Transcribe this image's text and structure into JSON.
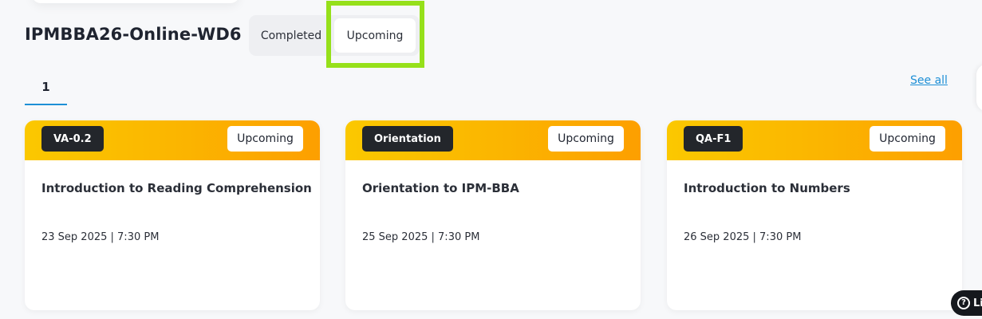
{
  "header": {
    "batch_title": "IPMBBA26-Online-WD6",
    "tabs": [
      {
        "label": "Completed",
        "selected": false
      },
      {
        "label": "Upcoming",
        "selected": true
      }
    ]
  },
  "pagination": {
    "current_page": "1"
  },
  "see_all_label": "See all",
  "cards": [
    {
      "code": "VA-0.2",
      "status": "Upcoming",
      "title": "Introduction to Reading Comprehension",
      "datetime": "23 Sep 2025 | 7:30 PM"
    },
    {
      "code": "Orientation",
      "status": "Upcoming",
      "title": "Orientation to IPM-BBA",
      "datetime": "25 Sep 2025 | 7:30 PM"
    },
    {
      "code": "QA-F1",
      "status": "Upcoming",
      "title": "Introduction to Numbers",
      "datetime": "26 Sep 2025 | 7:30 PM"
    }
  ],
  "help_widget": {
    "icon": "?",
    "label": "Li"
  },
  "colors": {
    "accent_link": "#1e8fd6",
    "card_header_gradient_start": "#fbc800",
    "card_header_gradient_end": "#fd9f00",
    "highlight": "#96e01a",
    "badge_dark": "#23262b"
  }
}
